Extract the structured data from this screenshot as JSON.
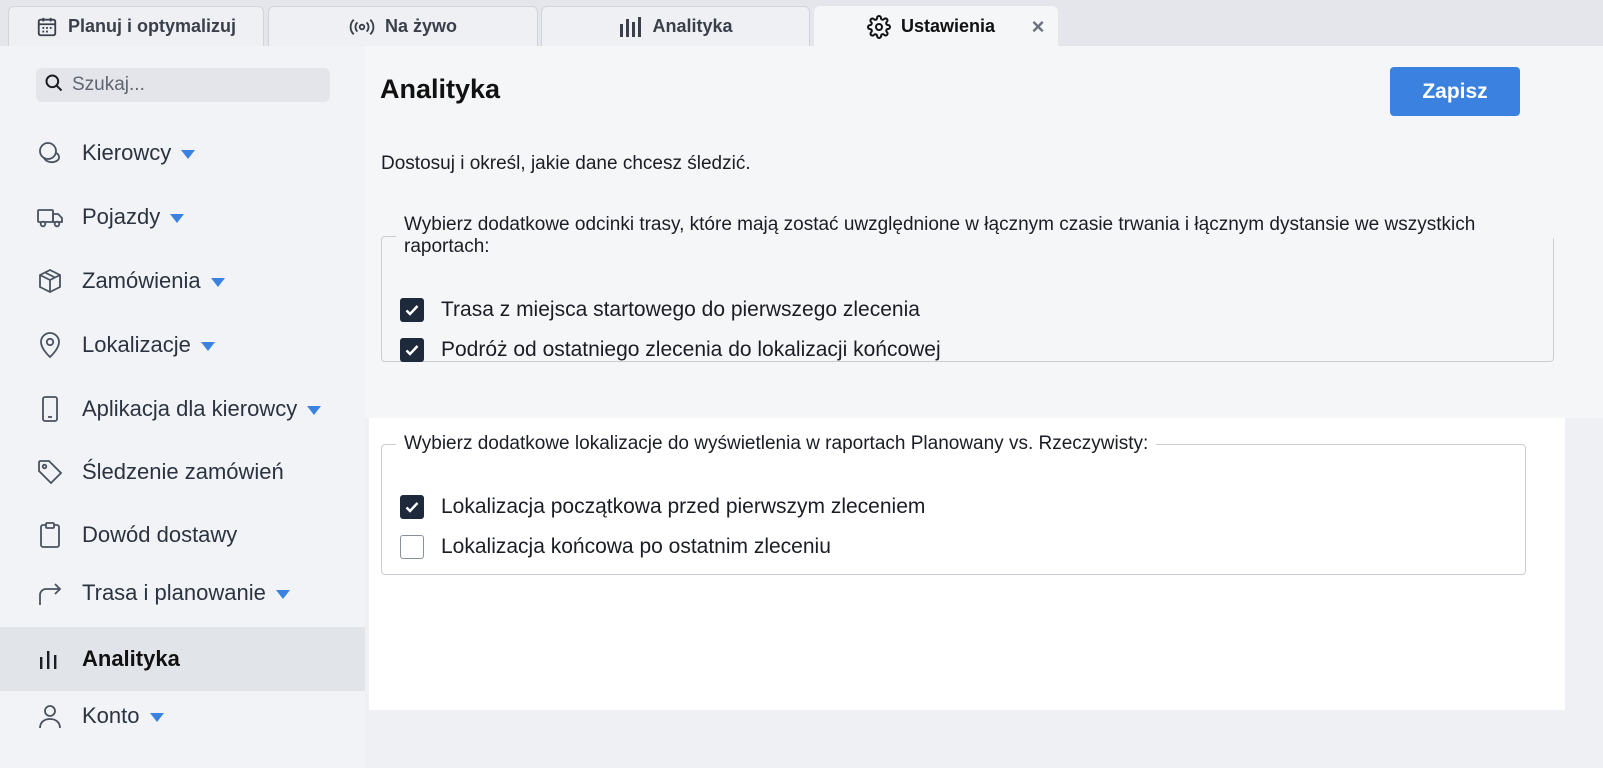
{
  "tabs": [
    {
      "label": "Planuj i optymalizuj",
      "icon": "calendar-icon"
    },
    {
      "label": "Na żywo",
      "icon": "broadcast-icon"
    },
    {
      "label": "Analityka",
      "icon": "bar-chart-icon"
    },
    {
      "label": "Ustawienia",
      "icon": "gear-icon",
      "active": true,
      "close": "×"
    }
  ],
  "sidebar": {
    "search_placeholder": "Szukaj...",
    "items": [
      {
        "label": "Kierowcy",
        "icon": "drivers-icon",
        "expandable": true
      },
      {
        "label": "Pojazdy",
        "icon": "truck-icon",
        "expandable": true
      },
      {
        "label": "Zamówienia",
        "icon": "package-icon",
        "expandable": true
      },
      {
        "label": "Lokalizacje",
        "icon": "map-pin-icon",
        "expandable": true
      },
      {
        "label": "Aplikacja dla kierowcy",
        "icon": "phone-icon",
        "expandable": true
      },
      {
        "label": "Śledzenie zamówień",
        "icon": "tag-icon",
        "expandable": false
      },
      {
        "label": "Dowód dostawy",
        "icon": "clipboard-icon",
        "expandable": false
      },
      {
        "label": "Trasa i planowanie",
        "icon": "route-arrow-icon",
        "expandable": true
      },
      {
        "label": "Analityka",
        "icon": "analytics-icon",
        "expandable": false,
        "active": true
      },
      {
        "label": "Konto",
        "icon": "user-icon",
        "expandable": true
      }
    ]
  },
  "main": {
    "title": "Analityka",
    "save_label": "Zapisz",
    "subtitle": "Dostosuj i określ, jakie dane chcesz śledzić.",
    "groups": [
      {
        "legend": "Wybierz dodatkowe odcinki trasy, które mają zostać uwzględnione w łącznym czasie trwania i łącznym dystansie we wszystkich raportach:",
        "options": [
          {
            "label": "Trasa z miejsca startowego do pierwszego zlecenia",
            "checked": true
          },
          {
            "label": "Podróż od ostatniego zlecenia do lokalizacji końcowej",
            "checked": true
          }
        ]
      },
      {
        "legend": "Wybierz dodatkowe lokalizacje do wyświetlenia w raportach Planowany vs. Rzeczywisty:",
        "options": [
          {
            "label": "Lokalizacja początkowa przed pierwszym zleceniem",
            "checked": true
          },
          {
            "label": "Lokalizacja końcowa po ostatnim zleceniu",
            "checked": false
          }
        ]
      }
    ]
  },
  "colors": {
    "accent": "#3b82e0",
    "checkbox_checked": "#1e2a3c"
  }
}
